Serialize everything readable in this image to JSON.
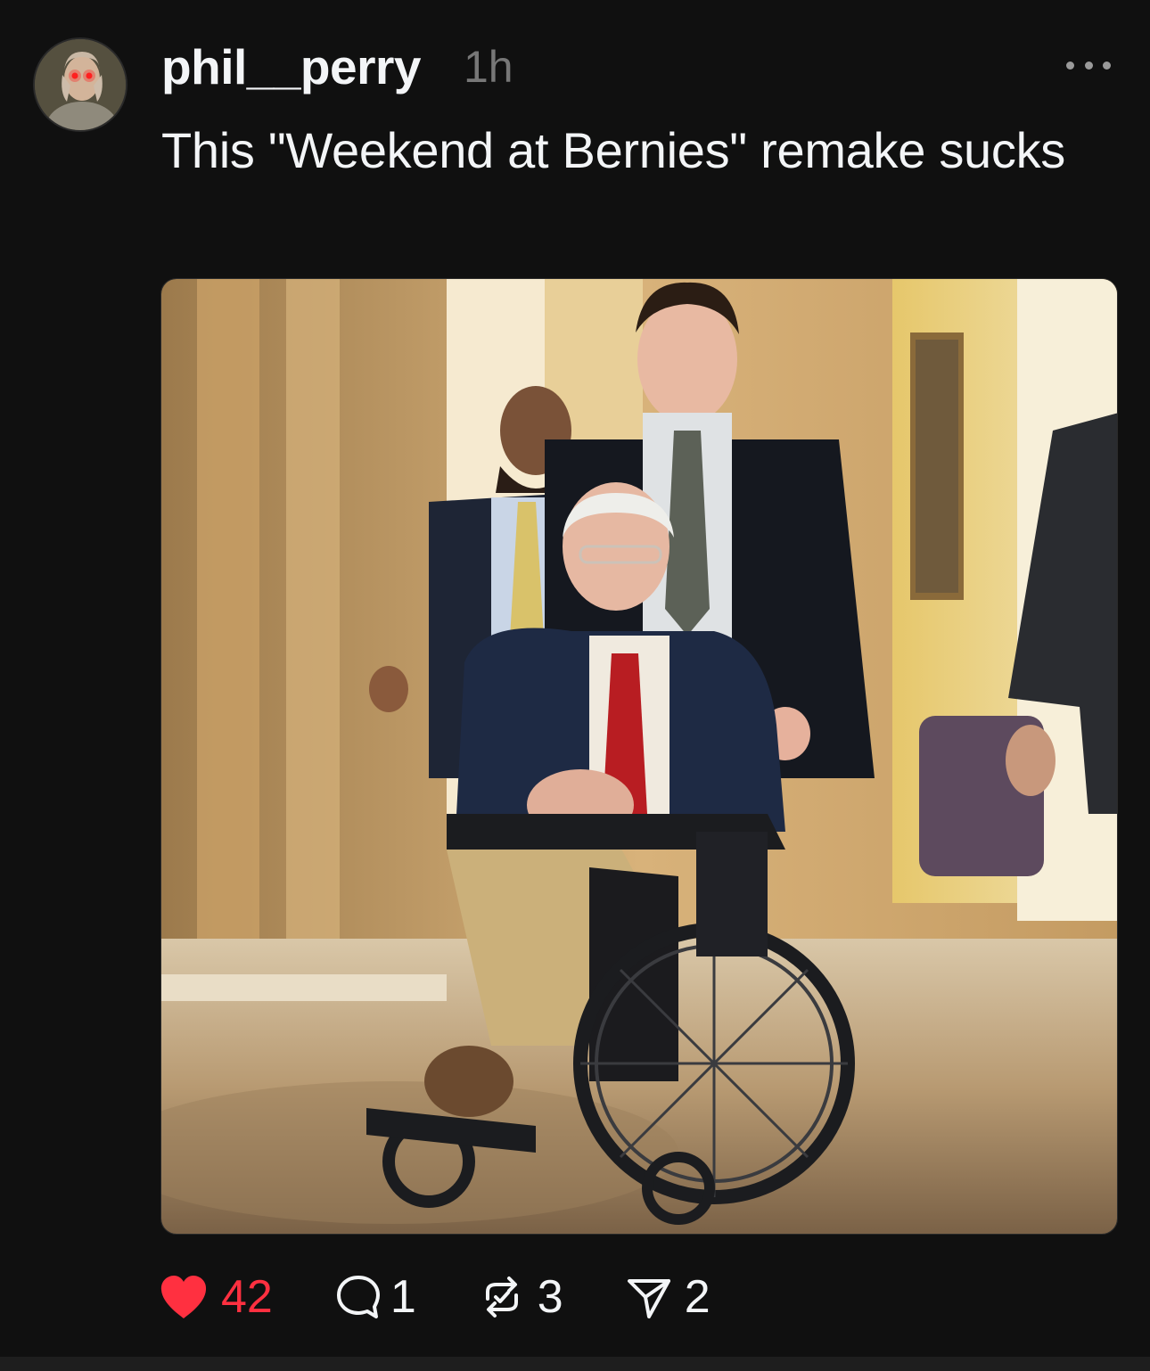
{
  "post": {
    "username": "phil__perry",
    "timestamp": "1h",
    "text": "This \"Weekend at Bernies\" remake sucks",
    "image_description_icon": "photo",
    "actions": {
      "likes": "42",
      "replies": "1",
      "reposts": "3",
      "shares": "2"
    }
  },
  "colors": {
    "background": "#101010",
    "like_red": "#ff3040",
    "text": "#f3f5f7",
    "muted": "#777777"
  }
}
